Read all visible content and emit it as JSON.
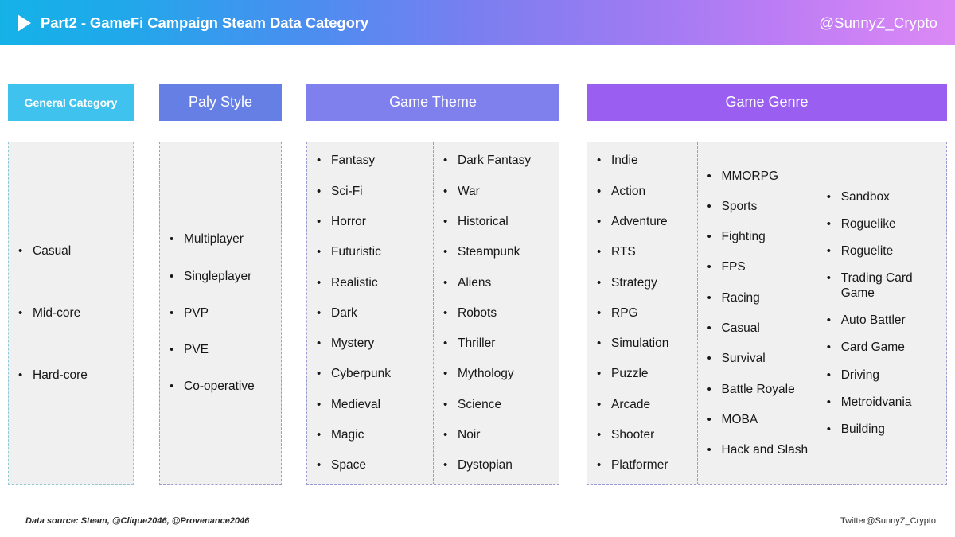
{
  "header": {
    "play_icon": "play-triangle-icon",
    "title": "Part2 - GameFi Campaign Steam Data Category",
    "handle": "@SunnyZ_Crypto",
    "gradient_start": "#15b2e8",
    "gradient_end": "#db8af5"
  },
  "columns": [
    {
      "id": "general",
      "title": "General Category",
      "chip_color": "#3fc2ee",
      "border_color": "#8fc8d8",
      "subcolumns": [
        {
          "items": [
            "Casual",
            "Mid-core",
            "Hard-core"
          ]
        }
      ]
    },
    {
      "id": "play",
      "title": "Paly Style",
      "chip_color": "#667fe5",
      "border_color": "#9b9bd2",
      "subcolumns": [
        {
          "items": [
            "Multiplayer",
            "Singleplayer",
            "PVP",
            "PVE",
            "Co-operative"
          ]
        }
      ]
    },
    {
      "id": "theme",
      "title": "Game Theme",
      "chip_color": "#7f80ee",
      "border_color": "#9b9bd2",
      "subcolumns": [
        {
          "items": [
            "Fantasy",
            "Sci-Fi",
            "Horror",
            "Futuristic",
            "Realistic",
            "Dark",
            "Mystery",
            "Cyberpunk",
            "Medieval",
            "Magic",
            "Space"
          ]
        },
        {
          "items": [
            "Dark Fantasy",
            "War",
            "Historical",
            "Steampunk",
            "Aliens",
            "Robots",
            "Thriller",
            "Mythology",
            "Science",
            "Noir",
            "Dystopian"
          ]
        }
      ]
    },
    {
      "id": "genre",
      "title": "Game Genre",
      "chip_color": "#9a5ef0",
      "border_color": "#9b9bd2",
      "subcolumns": [
        {
          "items": [
            "Indie",
            "Action",
            "Adventure",
            "RTS",
            "Strategy",
            "RPG",
            "Simulation",
            "Puzzle",
            "Arcade",
            "Shooter",
            "Platformer"
          ]
        },
        {
          "items": [
            "MMORPG",
            "Sports",
            "Fighting",
            "FPS",
            "Racing",
            "Casual",
            "Survival",
            "Battle Royale",
            "MOBA",
            "Hack and Slash"
          ]
        },
        {
          "items": [
            "Sandbox",
            "Roguelike",
            "Roguelite",
            "Trading Card Game",
            "Auto Battler",
            "Card Game",
            "Driving",
            "Metroidvania",
            "Building"
          ]
        }
      ]
    }
  ],
  "footer": {
    "source": "Data source: Steam, @Clique2046, @Provenance2046",
    "credit": "Twitter@SunnyZ_Crypto"
  }
}
